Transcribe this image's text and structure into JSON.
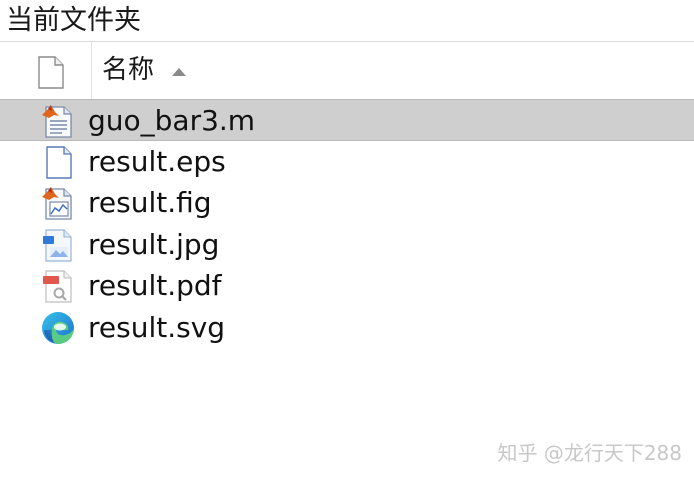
{
  "panel": {
    "title": "当前文件夹"
  },
  "columns": {
    "name_label": "名称",
    "sort": "ascending"
  },
  "files": [
    {
      "name": "guo_bar3.m",
      "icon": "matlab-script-icon",
      "selected": true
    },
    {
      "name": "result.eps",
      "icon": "blank-document-icon",
      "selected": false
    },
    {
      "name": "result.fig",
      "icon": "matlab-figure-icon",
      "selected": false
    },
    {
      "name": "result.jpg",
      "icon": "image-file-icon",
      "selected": false
    },
    {
      "name": "result.pdf",
      "icon": "pdf-file-icon",
      "selected": false
    },
    {
      "name": "result.svg",
      "icon": "edge-browser-icon",
      "selected": false
    }
  ],
  "watermark": "知乎 @龙行天下288"
}
